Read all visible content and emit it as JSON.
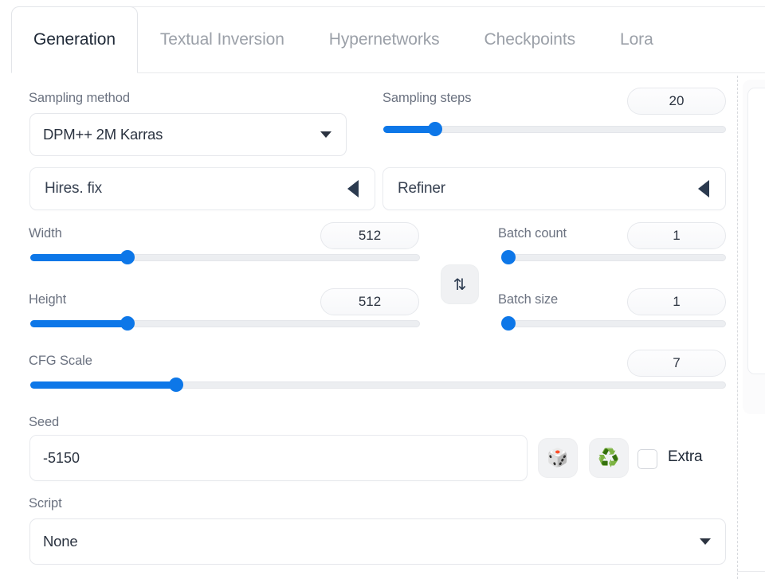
{
  "tabs": [
    {
      "label": "Generation",
      "active": true
    },
    {
      "label": "Textual Inversion",
      "active": false
    },
    {
      "label": "Hypernetworks",
      "active": false
    },
    {
      "label": "Checkpoints",
      "active": false
    },
    {
      "label": "Lora",
      "active": false
    }
  ],
  "fields": {
    "sampling_method": {
      "label": "Sampling method",
      "value": "DPM++ 2M Karras",
      "icon": "chevron-down-icon"
    },
    "sampling_steps": {
      "label": "Sampling steps",
      "value": "20",
      "slider_percent": 15
    },
    "hires_fix": {
      "label": "Hires. fix",
      "icon": "triangle-left-icon",
      "expanded": false
    },
    "refiner": {
      "label": "Refiner",
      "icon": "triangle-left-icon",
      "expanded": false
    },
    "width": {
      "label": "Width",
      "value": "512",
      "slider_percent": 25
    },
    "height": {
      "label": "Height",
      "value": "512",
      "slider_percent": 25
    },
    "batch_count": {
      "label": "Batch count",
      "value": "1",
      "slider_percent": 0
    },
    "batch_size": {
      "label": "Batch size",
      "value": "1",
      "slider_percent": 0
    },
    "cfg_scale": {
      "label": "CFG Scale",
      "value": "7",
      "slider_percent": 21
    },
    "seed": {
      "label": "Seed",
      "value": "-5150",
      "placeholder": ""
    },
    "script": {
      "label": "Script",
      "value": "None",
      "icon": "chevron-down-icon"
    }
  },
  "buttons": {
    "swap_dimensions": {
      "glyph": "⇅",
      "icon": "swap-arrows-icon"
    },
    "random_seed": {
      "glyph": "🎲",
      "icon": "dice-icon"
    },
    "recycle_seed": {
      "glyph": "♻️",
      "icon": "recycle-icon"
    }
  },
  "extra": {
    "label": "Extra",
    "checked": false
  },
  "colors": {
    "accent": "#0d77e8",
    "track": "#eceef1",
    "label_text": "#6b7280",
    "value_text": "#2b3340",
    "tab_inactive": "#9ba0a8",
    "tab_active": "#1f2937",
    "border": "#e5e7eb"
  }
}
